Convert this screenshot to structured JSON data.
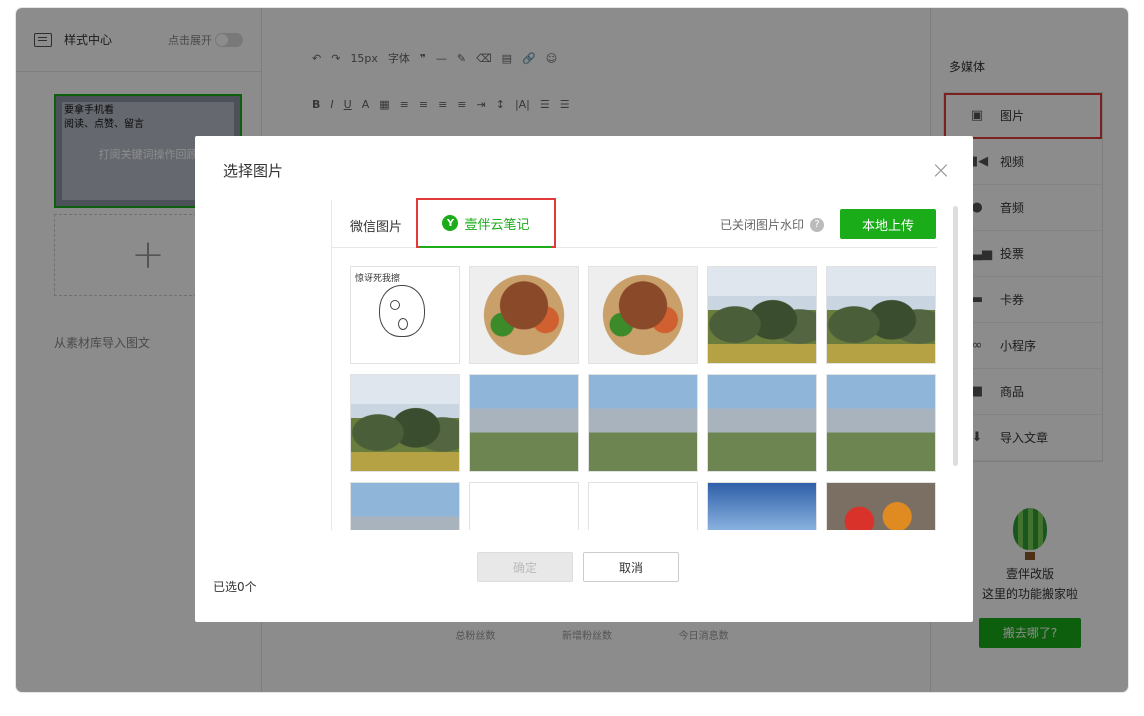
{
  "left_panel": {
    "title": "样式中心",
    "expand_label": "点击展开",
    "thumb_text": "要拿手机看\n阅读、点赞、留言",
    "thumb_caption": "打阅关键词操作回顾",
    "import_label": "从素材库导入图文"
  },
  "toolbar": {
    "font_size": "15px",
    "font_label": "字体"
  },
  "stats": [
    "总粉丝数",
    "新增粉丝数",
    "今日消息数"
  ],
  "right_panel": {
    "title": "多媒体",
    "items": [
      {
        "label": "图片",
        "icon": "image-icon"
      },
      {
        "label": "视频",
        "icon": "video-icon"
      },
      {
        "label": "音频",
        "icon": "microphone-icon"
      },
      {
        "label": "投票",
        "icon": "bar-chart-icon"
      },
      {
        "label": "卡券",
        "icon": "card-icon"
      },
      {
        "label": "小程序",
        "icon": "mini-program-icon"
      },
      {
        "label": "商品",
        "icon": "shopping-bag-icon"
      },
      {
        "label": "导入文章",
        "icon": "download-icon"
      }
    ],
    "promo_line1": "壹伴改版",
    "promo_line2": "这里的功能搬家啦",
    "promo_button": "搬去哪了?"
  },
  "modal": {
    "title": "选择图片",
    "close_icon": "×",
    "tabs": {
      "wechat": "微信图片",
      "yiban": "壹伴云笔记"
    },
    "watermark_text": "已关闭图片水印",
    "upload_label": "本地上传",
    "meme_text": "惊讶死我擦",
    "selected_text": "已选0个",
    "ok_label": "确定",
    "cancel_label": "取消"
  },
  "colors": {
    "accent": "#1aad19",
    "highlight": "#e23a3a"
  }
}
